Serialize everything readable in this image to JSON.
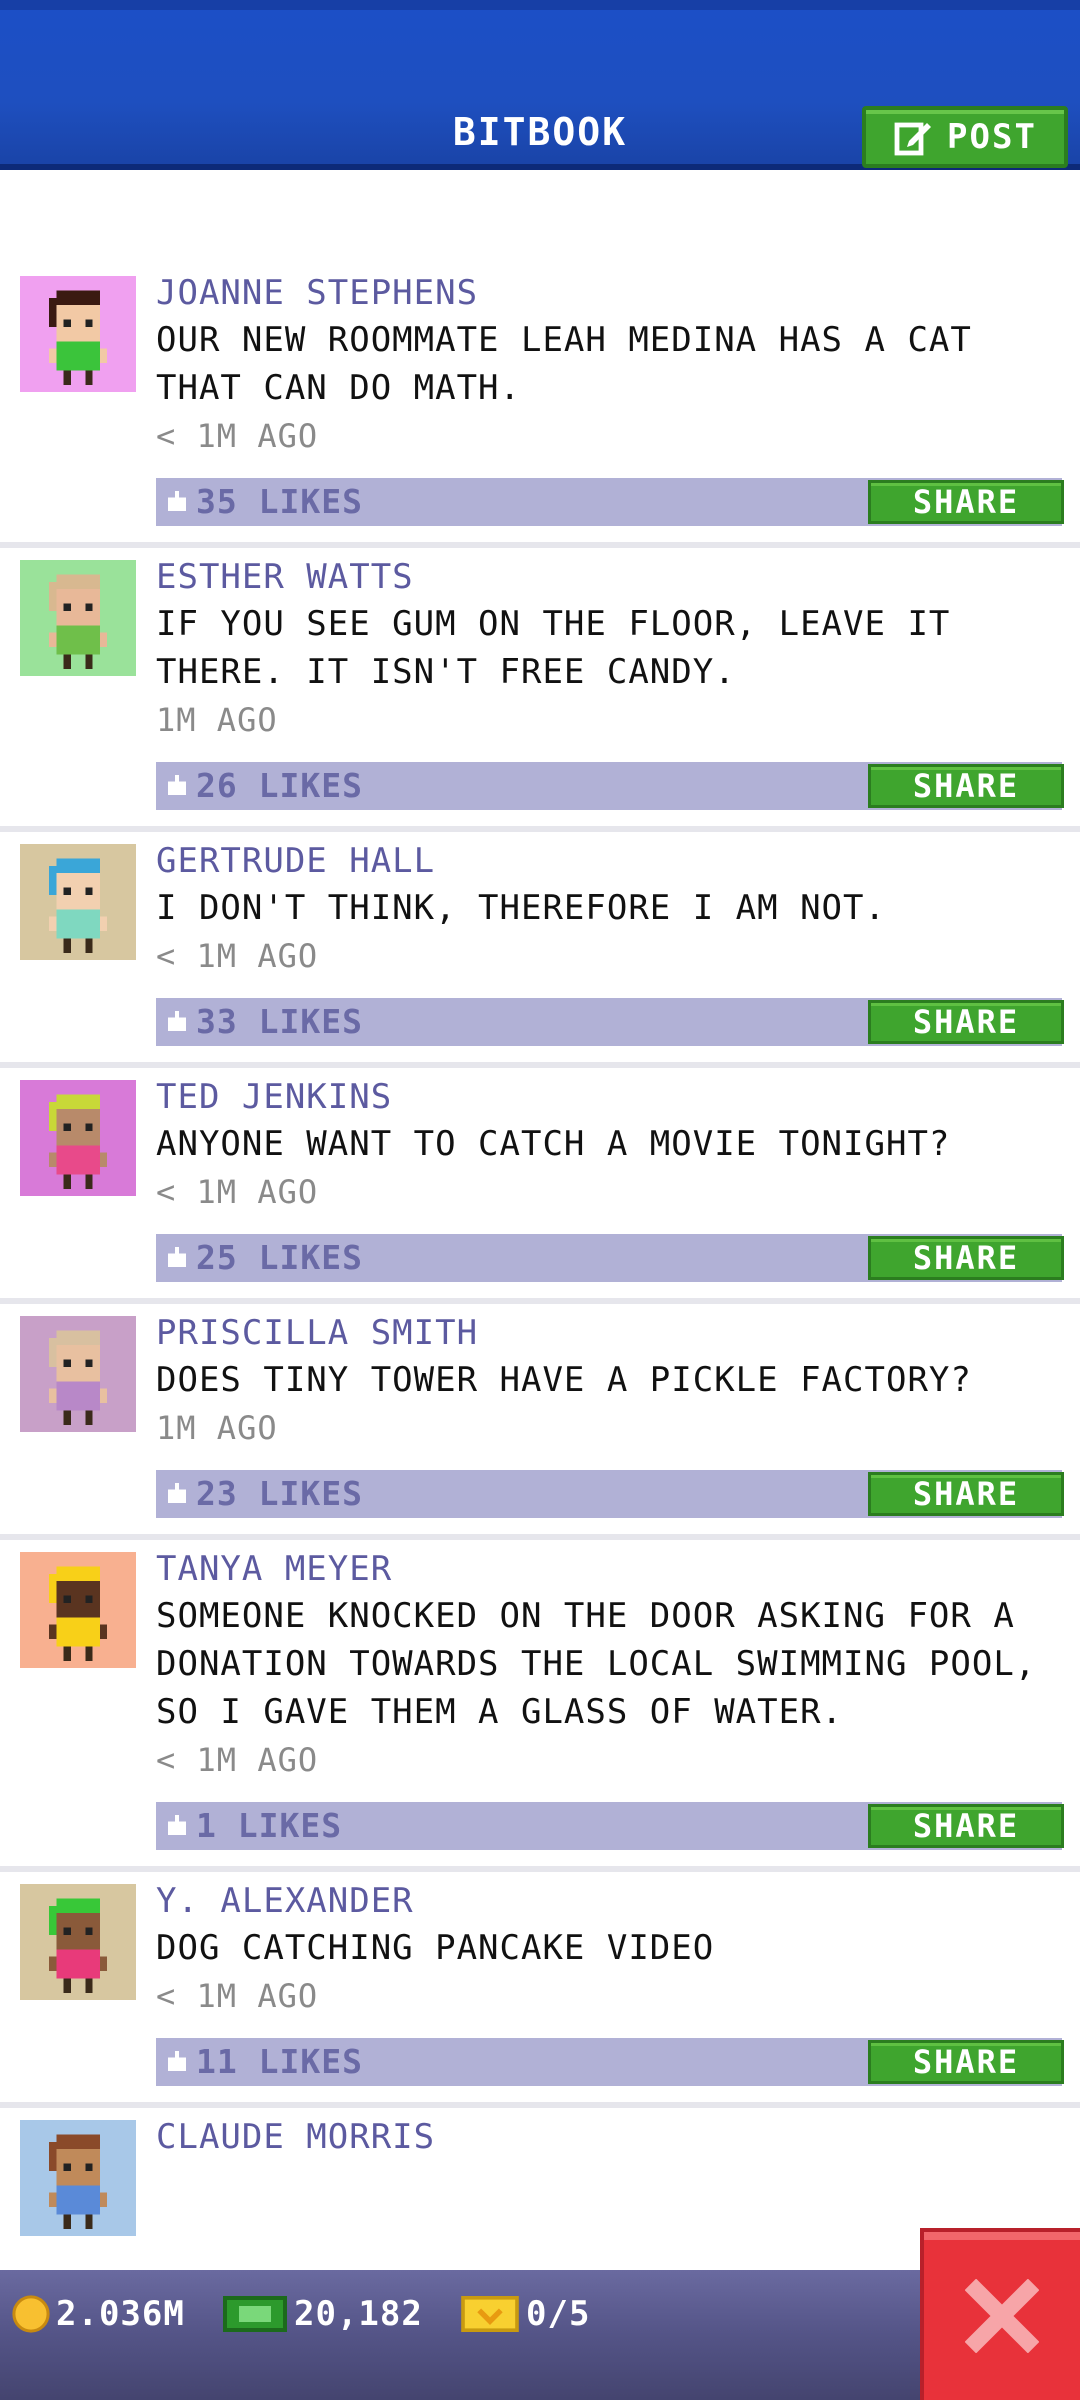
{
  "header": {
    "title": "BITBOOK",
    "post_label": "POST"
  },
  "posts": [
    {
      "author": "JOANNE STEPHENS",
      "message": "OUR NEW ROOMMATE LEAH MEDINA HAS A CAT THAT CAN DO MATH.",
      "time": "< 1M AGO",
      "likes": "35 LIKES",
      "share": "SHARE",
      "avatar_bg": "#f0a0f0",
      "skin": "#f2c9a5",
      "hair": "#3a1a12",
      "shirt": "#3bc43b"
    },
    {
      "author": "ESTHER WATTS",
      "message": "IF YOU SEE GUM ON THE FLOOR, LEAVE IT THERE. IT ISN'T FREE CANDY.",
      "time": "1M AGO",
      "likes": "26 LIKES",
      "share": "SHARE",
      "avatar_bg": "#9ae29a",
      "skin": "#e8b898",
      "hair": "#d8b890",
      "shirt": "#6fbf4a"
    },
    {
      "author": "GERTRUDE HALL",
      "message": "I DON'T THINK, THEREFORE I AM NOT.",
      "time": "< 1M AGO",
      "likes": "33 LIKES",
      "share": "SHARE",
      "avatar_bg": "#d7c7a0",
      "skin": "#f2d0b0",
      "hair": "#3aa6d8",
      "shirt": "#7fd8c0"
    },
    {
      "author": "TED JENKINS",
      "message": "ANYONE WANT TO CATCH A MOVIE TONIGHT?",
      "time": "< 1M AGO",
      "likes": "25 LIKES",
      "share": "SHARE",
      "avatar_bg": "#d87ad8",
      "skin": "#b88a6a",
      "hair": "#c8d838",
      "shirt": "#e84a8a"
    },
    {
      "author": "PRISCILLA SMITH",
      "message": "DOES TINY TOWER HAVE A PICKLE FACTORY?",
      "time": "1M AGO",
      "likes": "23 LIKES",
      "share": "SHARE",
      "avatar_bg": "#c8a0c8",
      "skin": "#e8c0a0",
      "hair": "#d8c0a0",
      "shirt": "#b888c8"
    },
    {
      "author": "TANYA MEYER",
      "message": "SOMEONE KNOCKED ON THE DOOR ASKING FOR A DONATION TOWARDS THE LOCAL SWIMMING POOL, SO I GAVE THEM A GLASS OF WATER.",
      "time": "< 1M AGO",
      "likes": "1 LIKES",
      "share": "SHARE",
      "avatar_bg": "#f8b090",
      "skin": "#5a3420",
      "hair": "#f8d018",
      "shirt": "#f8d018"
    },
    {
      "author": "Y. ALEXANDER",
      "message": "DOG CATCHING PANCAKE VIDEO",
      "time": "< 1M AGO",
      "likes": "11 LIKES",
      "share": "SHARE",
      "avatar_bg": "#d7c7a0",
      "skin": "#8a5a3a",
      "hair": "#38c838",
      "shirt": "#e83a7a"
    },
    {
      "author": "CLAUDE MORRIS",
      "message": "",
      "time": "",
      "likes": "",
      "share": "",
      "avatar_bg": "#a8c8e8",
      "skin": "#c08a5a",
      "hair": "#8a4a2a",
      "shirt": "#5a8ad8"
    }
  ],
  "status": {
    "coins": "2.036M",
    "bux": "20,182",
    "tickets": "0/5"
  },
  "colors": {
    "accent": "#1e4fbf",
    "share_green": "#3fa52e",
    "likes_bar": "#b1b1d6",
    "close_red": "#e8323a"
  }
}
